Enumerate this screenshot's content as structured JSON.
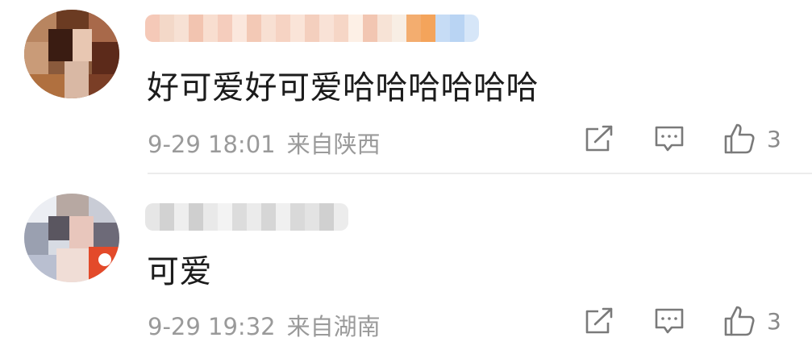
{
  "comments": [
    {
      "text": "好可爱好可爱哈哈哈哈哈哈",
      "date": "9-29 18:01",
      "location": "来自陕西",
      "likes": "3"
    },
    {
      "text": "可爱",
      "date": "9-29 19:32",
      "location": "来自湖南",
      "likes": "3"
    }
  ],
  "icons": {
    "share": "share-icon",
    "reply": "comment-icon",
    "like": "thumbs-up-icon"
  },
  "colors": {
    "text": "#1c1c1c",
    "meta": "#9a9a9a",
    "icon": "#7a7a7a",
    "divider": "#ececec"
  }
}
